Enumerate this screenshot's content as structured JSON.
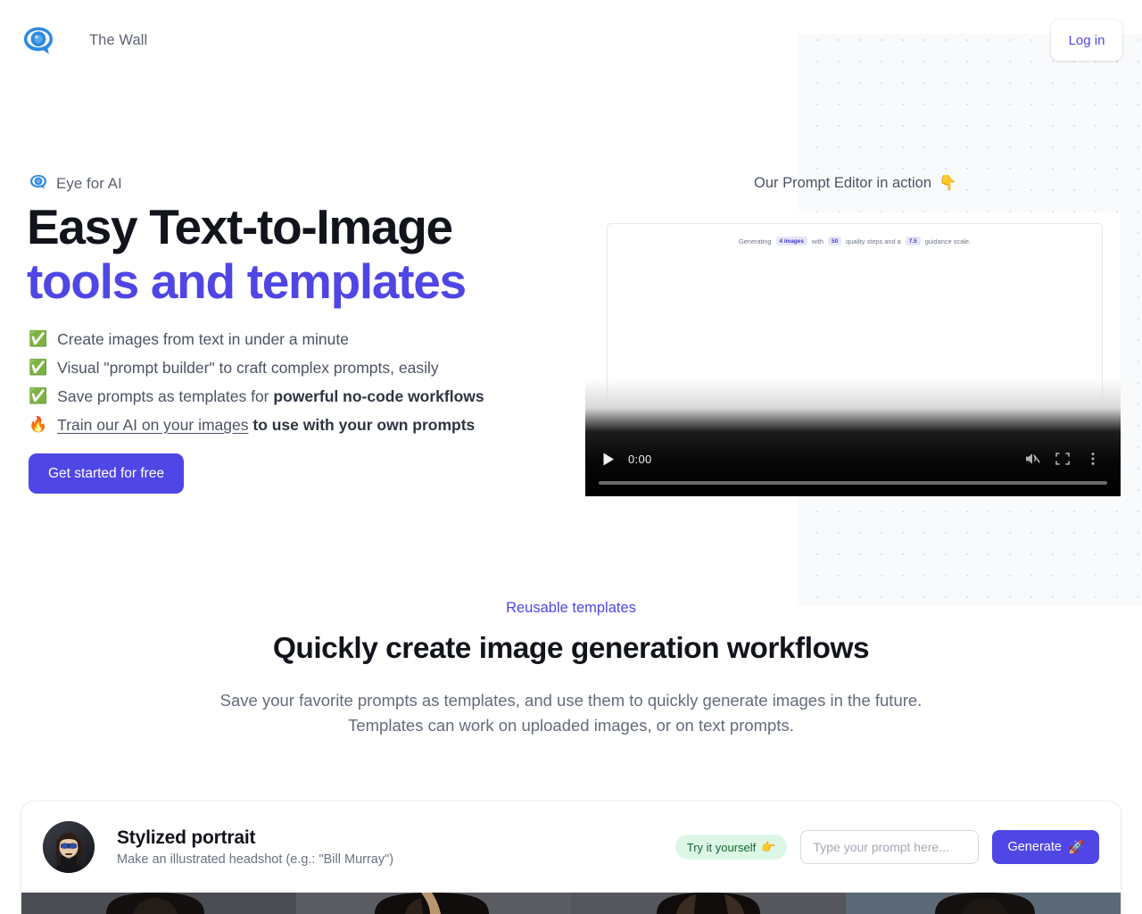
{
  "header": {
    "brand_name": "The Wall",
    "logo_icon": "eye-speech-bubble-logo",
    "login_label": "Log in"
  },
  "hero": {
    "eyebrow_icon": "eye-icon",
    "eyebrow": "Eye for AI",
    "headline_line1": "Easy Text-to-Image",
    "headline_line2": "tools and templates",
    "features": [
      {
        "icon": "✅",
        "icon_name": "check-mark-emoji",
        "text": "Create images from text in under a minute"
      },
      {
        "icon": "✅",
        "icon_name": "check-mark-emoji",
        "text": "Visual \"prompt builder\" to craft complex prompts, easily"
      },
      {
        "icon": "✅",
        "icon_name": "check-mark-emoji",
        "text_plain": "Save prompts as templates for ",
        "text_bold": "powerful no-code workflows"
      },
      {
        "icon": "🔥",
        "icon_name": "fire-emoji",
        "text_link": "Train our AI on your images",
        "text_bold": " to use with your own prompts"
      }
    ],
    "cta_label": "Get started for free"
  },
  "video": {
    "caption": "Our Prompt Editor in action",
    "caption_emoji": "👇",
    "caption_emoji_name": "pointing-down-emoji",
    "overlay_text_prefix": "Generating",
    "overlay_chip_images": "4 images",
    "overlay_text_mid1": "with",
    "overlay_chip_steps": "50",
    "overlay_text_mid2": "quality steps and a",
    "overlay_chip_guidance": "7.5",
    "overlay_text_suffix": "guidance scale.",
    "current_time": "0:00",
    "play_icon": "play-icon",
    "mute_icon": "muted-volume-icon",
    "fullscreen_icon": "fullscreen-icon",
    "more_icon": "kebab-menu-icon",
    "spinner_icon": "loading-spinner-icon"
  },
  "mid_section": {
    "eyebrow": "Reusable templates",
    "title": "Quickly create image generation workflows",
    "subtitle": "Save your favorite prompts as templates, and use them to quickly generate images in the future. Templates can work on uploaded images, or on text prompts."
  },
  "template_card": {
    "avatar_name": "stylized-portrait-avatar",
    "title": "Stylized portrait",
    "description": "Make an illustrated headshot (e.g.: \"Bill Murray\")",
    "try_badge": "Try it yourself",
    "try_badge_emoji": "👉",
    "try_badge_emoji_name": "pointing-right-emoji",
    "prompt_placeholder": "Type your prompt here...",
    "prompt_value": "",
    "generate_label": "Generate",
    "generate_emoji": "🚀",
    "generate_emoji_name": "rocket-emoji",
    "gallery_count": 4
  },
  "colors": {
    "accent_purple": "#4f46e5",
    "text_dark": "#12141c",
    "text_muted": "#646c7b",
    "badge_green_bg": "#ddf7e6",
    "badge_green_text": "#166534",
    "dot_pattern": "#dfe3ea",
    "panel_bg": "#f8fafc"
  }
}
